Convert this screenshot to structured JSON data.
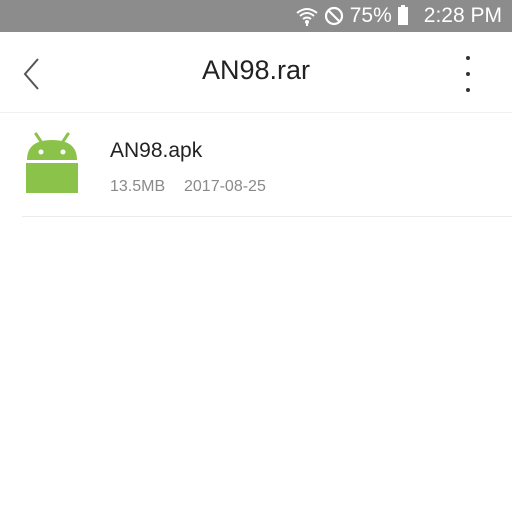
{
  "status_bar": {
    "battery": "75%",
    "time": "2:28 PM",
    "icons": [
      "wifi-icon",
      "do-not-disturb-icon",
      "battery-icon"
    ]
  },
  "toolbar": {
    "title": "AN98.rar",
    "icons": [
      "back-chevron-icon",
      "more-vert-icon"
    ]
  },
  "files": [
    {
      "name": "AN98.apk",
      "size": "13.5MB",
      "date": "2017-08-25",
      "icon": "android-icon",
      "icon_color": "#8bc34a"
    }
  ]
}
